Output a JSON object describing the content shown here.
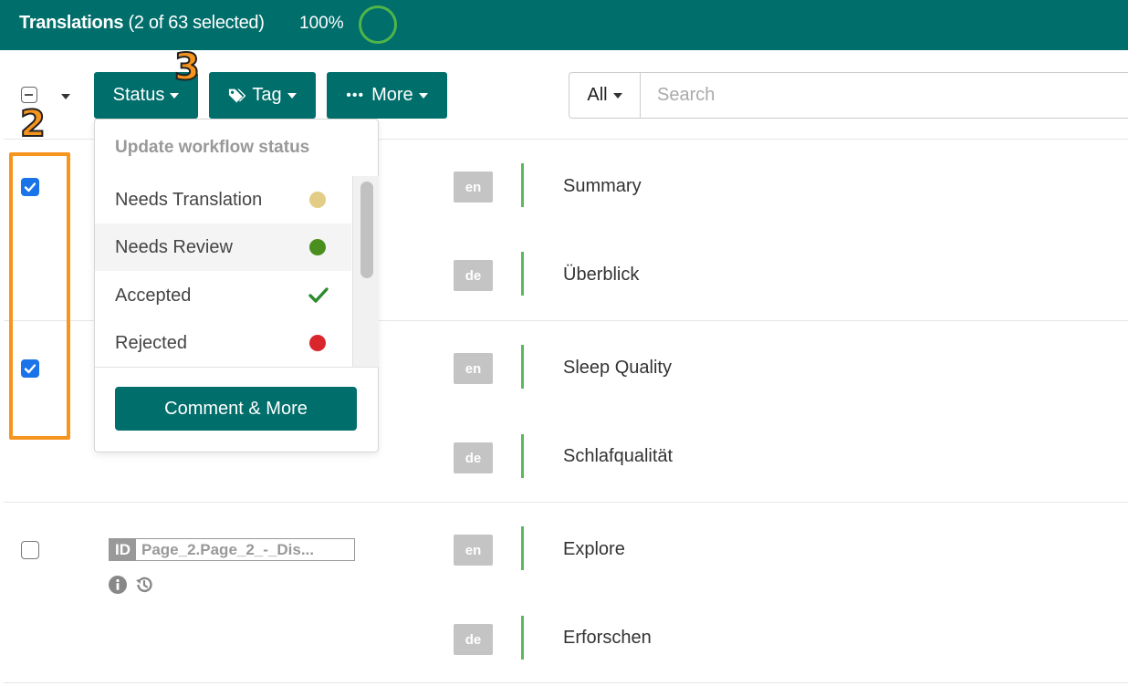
{
  "header": {
    "title": "Translations",
    "selection": "(2 of 63 selected)",
    "progress": "100%",
    "progress_value": 1.0
  },
  "toolbar": {
    "status_label": "Status",
    "tag_label": "Tag",
    "more_label": "More",
    "more_dots": "•••",
    "filter_selected": "All",
    "search_placeholder": "Search"
  },
  "status_menu": {
    "header": "Update workflow status",
    "items": [
      {
        "label": "Needs Translation",
        "color": "#e3cc86"
      },
      {
        "label": "Needs Review",
        "color": "#4a8f1d"
      },
      {
        "label": "Accepted",
        "color": "#2e8b2e"
      },
      {
        "label": "Rejected",
        "color": "#d9262c"
      }
    ],
    "button_label": "Comment & More"
  },
  "rows": [
    {
      "checked": true,
      "translations": [
        {
          "lang": "en",
          "text": "Summary"
        },
        {
          "lang": "de",
          "text": "Überblick"
        }
      ]
    },
    {
      "checked": true,
      "translations": [
        {
          "lang": "en",
          "text": "Sleep Quality"
        },
        {
          "lang": "de",
          "text": "Schlafqualität"
        }
      ]
    },
    {
      "checked": false,
      "id_tag": "ID",
      "id_value": "Page_2.Page_2_-_Dis...",
      "translations": [
        {
          "lang": "en",
          "text": "Explore"
        },
        {
          "lang": "de",
          "text": "Erforschen"
        }
      ]
    }
  ],
  "annotations": {
    "step_a": "2",
    "step_b": "3"
  },
  "colors": {
    "brand": "#006e6b",
    "accent_bar": "#5cb85c",
    "annotation": "#f7941d",
    "checkbox": "#1a73e8"
  }
}
